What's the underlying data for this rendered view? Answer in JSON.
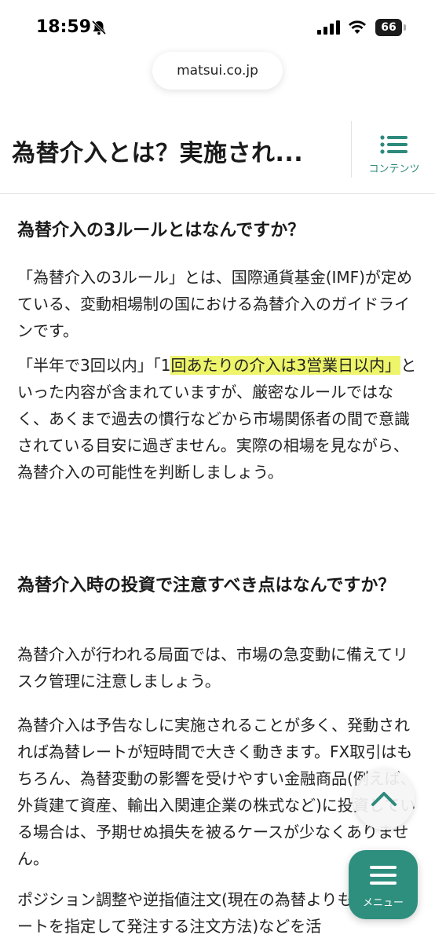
{
  "status_bar": {
    "time": "18:59",
    "battery": "66"
  },
  "browser": {
    "url": "matsui.co.jp"
  },
  "header": {
    "title": "為替介入とは？実施され...",
    "contents_label": "コンテンツ"
  },
  "article": {
    "section1": {
      "title": "為替介入の3ルールとはなんですか？",
      "p1": "「為替介入の3ルール」とは、国際通貨基金(IMF)が定めている、変動相場制の国における為替介入のガイドラインです。",
      "p2_a": "「半年で3回以内」「1",
      "p2_highlight": "回あたりの介入は3営業日以内」",
      "p2_b": "といった内容が含まれていますが、厳密なルールではなく、あくまで過去の慣行などから市場関係者の間で意識されている目安に過ぎません。実際の相場を見ながら、為替介入の可能性を判断しましょう。"
    },
    "section2": {
      "title": "為替介入時の投資で注意すべき点はなんですか？",
      "p1": "為替介入が行われる局面では、市場の急変動に備えてリスク管理に注意しましょう。",
      "p2": "為替介入は予告なしに実施されることが多く、発動されれば為替レートが短時間で大きく動きます。FX取引はもちろん、為替変動の影響を受けやすい金融商品(例えば、外貨建て資産、輸出入関連企業の株式など)に投資している場合は、予期せぬ損失を被るケースが少なくありません。",
      "p3": "ポジション調整や逆指値注文(現在の為替よりも不利なレートを指定して発注する注文方法)などを活"
    }
  },
  "floating": {
    "menu_label": "メニュー"
  },
  "colors": {
    "accent": "#2f8f7e",
    "highlight": "#eef56a"
  }
}
